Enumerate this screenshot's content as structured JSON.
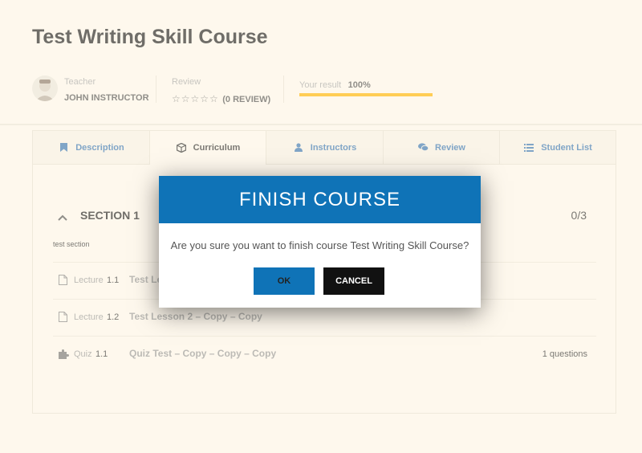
{
  "course": {
    "title": "Test Writing Skill Course"
  },
  "meta": {
    "teacher_label": "Teacher",
    "teacher_name": "JOHN INSTRUCTOR",
    "review_label": "Review",
    "stars": "☆☆☆☆☆",
    "review_count": "(0 REVIEW)",
    "result_label": "Your result",
    "result_value": "100%",
    "result_progress": 1.0,
    "progress_color": "#ffb606"
  },
  "tabs": [
    {
      "label": "Description",
      "icon": "bookmark-icon",
      "active": false
    },
    {
      "label": "Curriculum",
      "icon": "cube-icon",
      "active": true
    },
    {
      "label": "Instructors",
      "icon": "user-icon",
      "active": false
    },
    {
      "label": "Review",
      "icon": "comments-icon",
      "active": false
    },
    {
      "label": "Student List",
      "icon": "list-icon",
      "active": false
    }
  ],
  "section": {
    "title": "SECTION 1",
    "count": "0/3",
    "description": "test section",
    "items": [
      {
        "type": "Lecture",
        "number": "1.1",
        "title": "Test Lesson 1 – Copy – Copy",
        "right": "",
        "icon": "file-icon"
      },
      {
        "type": "Lecture",
        "number": "1.2",
        "title": "Test Lesson 2 – Copy – Copy",
        "right": "",
        "icon": "file-icon"
      },
      {
        "type": "Quiz",
        "number": "1.1",
        "title": "Quiz Test – Copy – Copy – Copy",
        "right": "1 questions",
        "icon": "puzzle-icon"
      }
    ]
  },
  "modal": {
    "title": "FINISH COURSE",
    "message": "Are you sure you want to finish course Test Writing Skill Course?",
    "ok_label": "OK",
    "cancel_label": "CANCEL"
  },
  "colors": {
    "accent": "#0f73b7",
    "background": "#fdf8ee",
    "tab_text": "#3c78b4"
  }
}
